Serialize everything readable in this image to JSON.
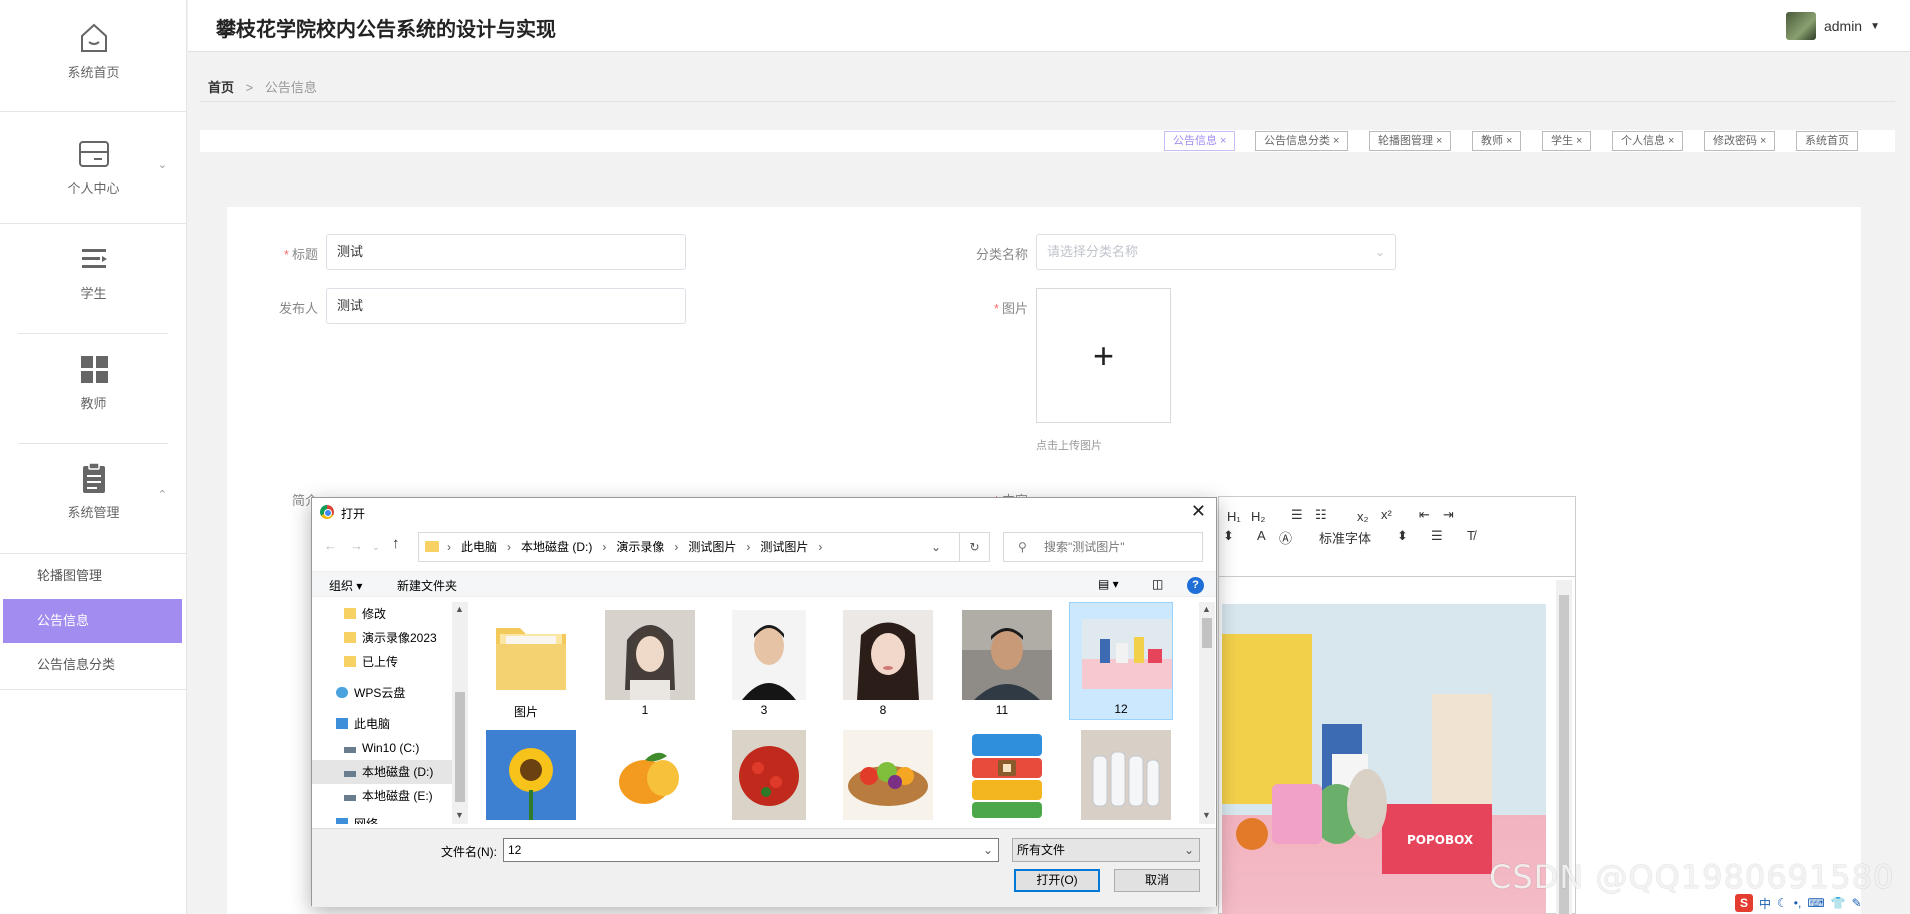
{
  "app": {
    "title": "攀枝花学院校内公告系统的设计与实现",
    "user": "admin"
  },
  "sidebar": {
    "items": [
      {
        "label": "系统首页",
        "icon": "home-icon"
      },
      {
        "label": "个人中心",
        "icon": "card-icon"
      },
      {
        "label": "学生",
        "icon": "list-icon"
      },
      {
        "label": "教师",
        "icon": "grid-icon"
      },
      {
        "label": "系统管理",
        "icon": "clipboard-icon"
      }
    ],
    "sub_items": [
      "轮播图管理",
      "公告信息",
      "公告信息分类"
    ]
  },
  "breadcrumb": {
    "home": "首页",
    "sep": ">",
    "current": "公告信息"
  },
  "tags": [
    "公告信息",
    "公告信息分类",
    "轮播图管理",
    "教师",
    "学生",
    "个人信息",
    "修改密码",
    "系统首页"
  ],
  "form": {
    "title_label": "标题",
    "title_value": "测试",
    "publisher_label": "发布人",
    "publisher_value": "测试",
    "category_label": "分类名称",
    "category_placeholder": "请选择分类名称",
    "image_label": "图片",
    "upload_hint": "点击上传图片",
    "summary_label": "简介",
    "content_label": "内容"
  },
  "editor": {
    "font_label": "标准字体"
  },
  "dialog": {
    "title": "打开",
    "path": [
      "此电脑",
      "本地磁盘 (D:)",
      "演示录像",
      "测试图片",
      "测试图片"
    ],
    "search_placeholder": "搜索\"测试图片\"",
    "organize": "组织 ▾",
    "new_folder": "新建文件夹",
    "tree": [
      {
        "label": "修改",
        "icon": "folder-icon"
      },
      {
        "label": "演示录像2023",
        "icon": "folder-icon"
      },
      {
        "label": "已上传",
        "icon": "folder-icon"
      },
      {
        "label": "WPS云盘",
        "icon": "cloud-icon"
      },
      {
        "label": "此电脑",
        "icon": "computer-icon"
      },
      {
        "label": "Win10 (C:)",
        "icon": "drive-icon"
      },
      {
        "label": "本地磁盘 (D:)",
        "icon": "drive-icon",
        "selected": true
      },
      {
        "label": "本地磁盘 (E:)",
        "icon": "drive-icon"
      },
      {
        "label": "网络",
        "icon": "network-icon"
      }
    ],
    "files": [
      {
        "name": "图片",
        "kind": "folder"
      },
      {
        "name": "1",
        "kind": "portrait-woman"
      },
      {
        "name": "3",
        "kind": "portrait-man"
      },
      {
        "name": "8",
        "kind": "portrait-woman2"
      },
      {
        "name": "11",
        "kind": "portrait-man2"
      },
      {
        "name": "12",
        "kind": "products",
        "selected": true
      },
      {
        "name": "",
        "kind": "sunflower"
      },
      {
        "name": "",
        "kind": "mango"
      },
      {
        "name": "",
        "kind": "strawberry"
      },
      {
        "name": "",
        "kind": "fruit-basket"
      },
      {
        "name": "",
        "kind": "archive"
      },
      {
        "name": "",
        "kind": "bottles"
      }
    ],
    "filename_label": "文件名(N):",
    "filename_value": "12",
    "filetype_value": "所有文件",
    "open_button": "打开(O)",
    "cancel_button": "取消"
  },
  "watermark": "CSDN @QQ1980691580",
  "colors": {
    "accent": "#a28cf0",
    "required": "#f56c6c",
    "dialog_select": "#cce8ff"
  }
}
